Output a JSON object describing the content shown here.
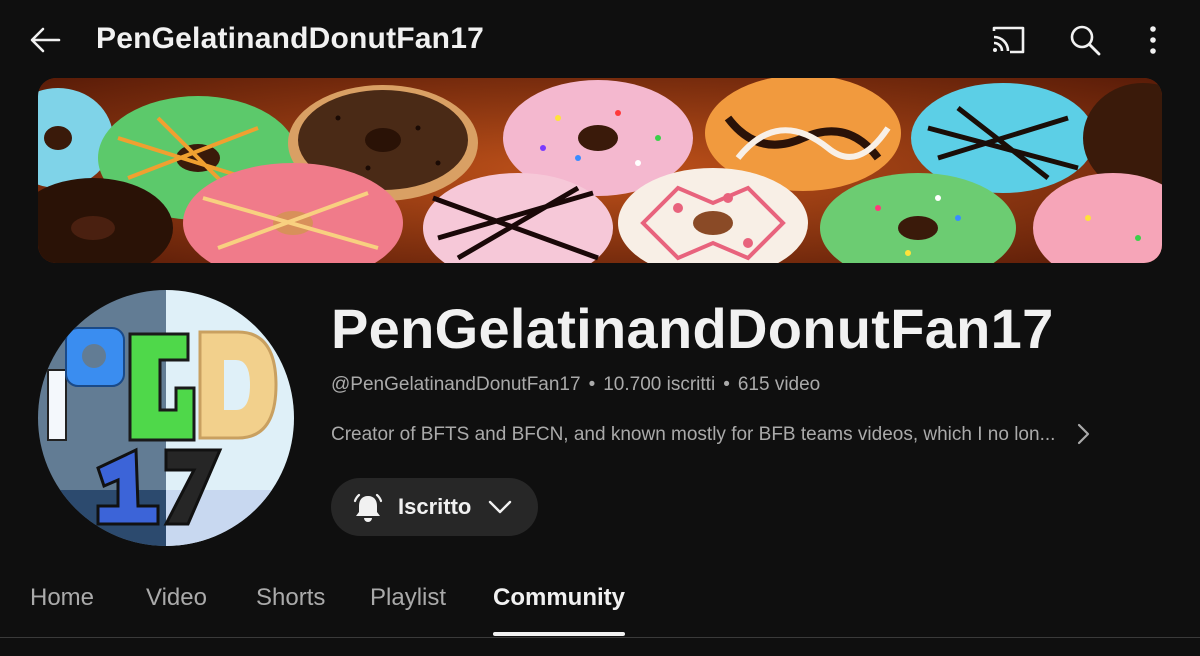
{
  "header": {
    "title": "PenGelatinandDonutFan17",
    "icons": [
      "back-arrow-icon",
      "cast-icon",
      "search-icon",
      "more-vert-icon"
    ]
  },
  "banner": {
    "subject": "donuts-banner-image"
  },
  "channel": {
    "name": "PenGelatinandDonutFan17",
    "handle": "@PenGelatinandDonutFan17",
    "subscribers": "10.700 iscritti",
    "videos": "615 video",
    "separator": "•",
    "description": "Creator of BFTS and BFCN, and known mostly for BFB teams videos, which I no lon...",
    "avatar_text": "PGD 17"
  },
  "subscribe": {
    "label": "Iscritto",
    "icon": "bell-icon"
  },
  "tabs": [
    {
      "label": "Home",
      "active": false
    },
    {
      "label": "Video",
      "active": false
    },
    {
      "label": "Shorts",
      "active": false
    },
    {
      "label": "Playlist",
      "active": false
    },
    {
      "label": "Community",
      "active": true
    }
  ],
  "colors": {
    "background": "#0f0f0f",
    "text_primary": "#f1f1f1",
    "text_secondary": "#aaaaaa",
    "button_bg": "#272727"
  }
}
